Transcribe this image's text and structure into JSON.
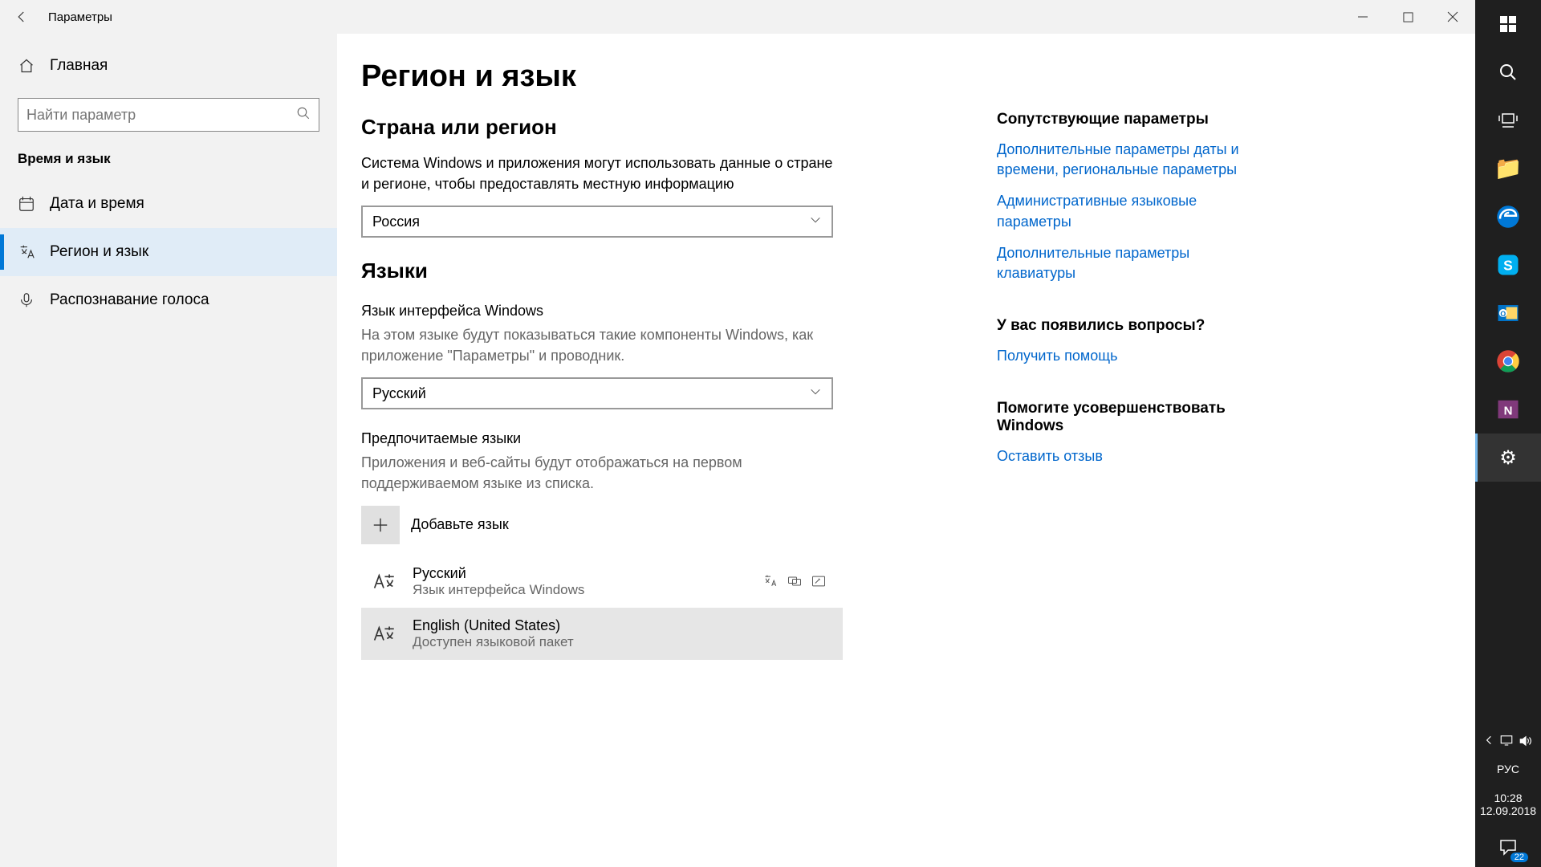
{
  "titlebar": {
    "title": "Параметры"
  },
  "sidebar": {
    "home": "Главная",
    "search_placeholder": "Найти параметр",
    "section": "Время и язык",
    "items": [
      {
        "label": "Дата и время"
      },
      {
        "label": "Регион и язык"
      },
      {
        "label": "Распознавание голоса"
      }
    ]
  },
  "main": {
    "page_title": "Регион и язык",
    "country_section": "Страна или регион",
    "country_desc": "Система Windows и приложения могут использовать данные о стране и регионе, чтобы предоставлять местную информацию",
    "country_value": "Россия",
    "languages_section": "Языки",
    "display_lang_label": "Язык интерфейса Windows",
    "display_lang_desc": "На этом языке будут показываться такие компоненты Windows, как приложение \"Параметры\" и проводник.",
    "display_lang_value": "Русский",
    "preferred_label": "Предпочитаемые языки",
    "preferred_desc": "Приложения и веб-сайты будут отображаться на первом поддерживаемом языке из списка.",
    "add_language": "Добавьте язык",
    "langs": [
      {
        "name": "Русский",
        "sub": "Язык интерфейса Windows"
      },
      {
        "name": "English (United States)",
        "sub": "Доступен языковой пакет"
      }
    ]
  },
  "aside": {
    "related_title": "Сопутствующие параметры",
    "links": [
      "Дополнительные параметры даты и времени, региональные параметры",
      "Административные языковые параметры",
      "Дополнительные параметры клавиатуры"
    ],
    "help_title": "У вас появились вопросы?",
    "help_link": "Получить помощь",
    "feedback_title": "Помогите усовершенствовать Windows",
    "feedback_link": "Оставить отзыв"
  },
  "taskbar": {
    "lang": "РУС",
    "time": "10:28",
    "date": "12.09.2018",
    "action_badge": "22"
  }
}
